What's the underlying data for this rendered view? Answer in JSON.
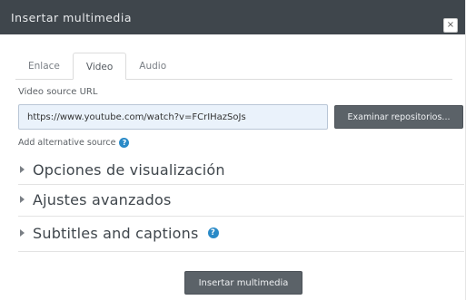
{
  "dialog": {
    "title": "Insertar multimedia",
    "close_label": "×"
  },
  "tabs": [
    {
      "label": "Enlace",
      "active": false
    },
    {
      "label": "Video",
      "active": true
    },
    {
      "label": "Audio",
      "active": false
    }
  ],
  "video_tab": {
    "source_label": "Video source URL",
    "source_value": "https://www.youtube.com/watch?v=FCrIHazSoJs",
    "browse_label": "Examinar repositorios...",
    "alt_source_label": "Add alternative source",
    "help_glyph": "?"
  },
  "sections": [
    {
      "label": "Opciones de visualización",
      "has_help": false
    },
    {
      "label": "Ajustes avanzados",
      "has_help": false
    },
    {
      "label": "Subtitles and captions",
      "has_help": true
    }
  ],
  "footer": {
    "insert_label": "Insertar multimedia"
  },
  "colors": {
    "titlebar": "#3f464c",
    "button": "#5b6268",
    "input_bg": "#eaf2fb",
    "help_icon": "#2a8ac7"
  },
  "icons": {
    "close": "close-icon",
    "help": "help-icon",
    "expand": "caret-right-icon"
  }
}
